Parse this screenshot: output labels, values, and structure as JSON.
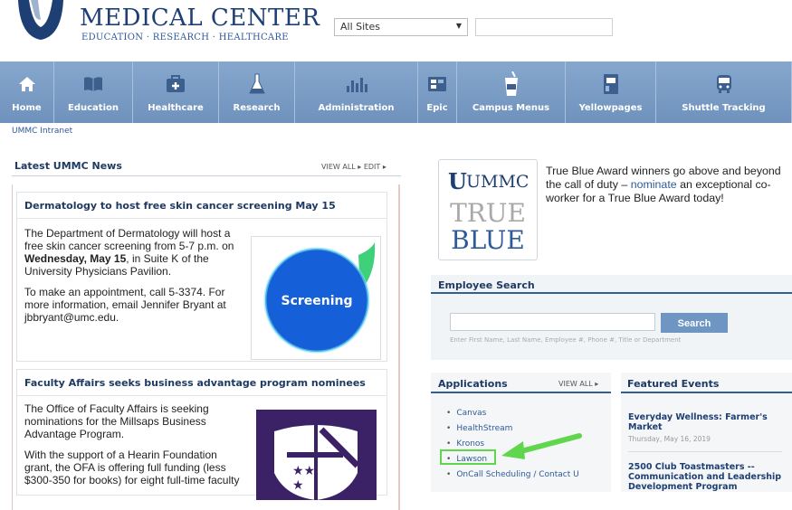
{
  "header": {
    "logo_title": "MEDICAL CENTER",
    "logo_subtitle": "EDUCATION · RESEARCH · HEALTHCARE",
    "site_select_value": "All Sites",
    "search_placeholder": ""
  },
  "nav": [
    {
      "label": "Home",
      "icon": "home-icon",
      "width": 60
    },
    {
      "label": "Education",
      "icon": "book-icon",
      "width": 87
    },
    {
      "label": "Healthcare",
      "icon": "medical-kit-icon",
      "width": 95
    },
    {
      "label": "Research",
      "icon": "flask-icon",
      "width": 84
    },
    {
      "label": "Administration",
      "icon": "bar-chart-icon",
      "width": 136
    },
    {
      "label": "Epic",
      "icon": "epic-screen-icon",
      "width": 43
    },
    {
      "label": "Campus Menus",
      "icon": "drink-cup-icon",
      "width": 120
    },
    {
      "label": "Yellowpages",
      "icon": "phonebook-icon",
      "width": 100
    },
    {
      "label": "Shuttle Tracking",
      "icon": "bus-icon",
      "width": 150
    }
  ],
  "breadcrumb": "UMMC Intranet",
  "news": {
    "title": "Latest UMMC News",
    "links": "VIEW ALL ▸  EDIT ▸",
    "item1": {
      "title": "Dermatology to host free skin cancer screening May 15",
      "p1_a": "The Department of Dermatology will host a free skin cancer screening from 5-7 p.m. on ",
      "p1_bold": "Wednesday, May 15",
      "p1_b": ", in Suite K of the University Physicians Pavilion.",
      "p2": "To make an appointment, call 5-3374. For more information, email Jennifer Bryant at jbbryant@umc.edu.",
      "image_text": "Screening"
    },
    "item2": {
      "title": "Faculty Affairs seeks business advantage program nominees",
      "p1": "The Office of Faculty Affairs is seeking nominations for the Millsaps Business Advantage Program.",
      "p2": "With the support of a Hearin Foundation grant, the OFA is offering full funding (less $300-350 for books) for eight full-time faculty"
    }
  },
  "true_blue": {
    "logo_ummc": "UMMC",
    "logo_true": "TRUE",
    "logo_blue": "BLUE",
    "text_a": "True Blue Award winners go above and beyond the call of duty – ",
    "link": "nominate",
    "text_b": " an exceptional co-worker for a True Blue Award today!"
  },
  "employee_search": {
    "title": "Employee Search",
    "button": "Search",
    "hint": "Enter First Name, Last Name, Employee #, Phone #, Title or Department"
  },
  "applications": {
    "title": "Applications",
    "view_all": "VIEW ALL ▸",
    "items": [
      "Canvas",
      "HealthStream",
      "Kronos",
      "Lawson",
      "OnCall Scheduling / Contact U"
    ]
  },
  "featured_events": {
    "title": "Featured Events",
    "event1_title": "Everyday Wellness: Farmer's Market",
    "event1_date": "Thursday, May 16, 2019",
    "event2_title": "2500 Club Toastmasters -- Communication and Leadership Development Program"
  },
  "colors": {
    "nav_bg": "#7b9cc6",
    "accent_blue": "#1e3a63",
    "highlight_green": "#5fd64b"
  }
}
